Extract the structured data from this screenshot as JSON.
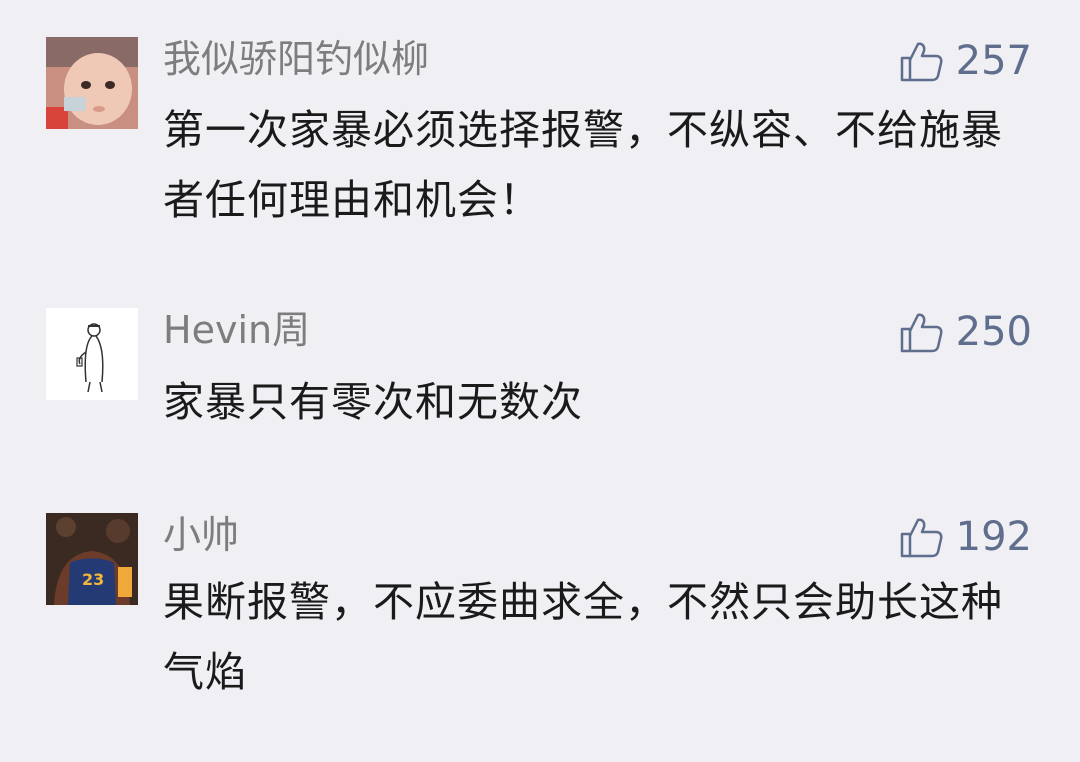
{
  "comments": [
    {
      "nickname": "我似骄阳钓似柳",
      "likes": "257",
      "content": "第一次家暴必须选择报警，不纵容、不给施暴者任何理由和机会！",
      "avatar_icon": "baby-photo-avatar"
    },
    {
      "nickname": "Hevin周",
      "likes": "250",
      "content": "家暴只有零次和无数次",
      "avatar_icon": "sketch-person-avatar"
    },
    {
      "nickname": "小帅",
      "likes": "192",
      "content": "果断报警，不应委曲求全，不然只会助长这种气焰",
      "avatar_icon": "basketball-player-avatar"
    }
  ],
  "like_icon": "thumbs-up-icon",
  "colors": {
    "background": "#efeff4",
    "nickname": "#7d7d7d",
    "like": "#5f6e8c",
    "content": "#1a1a1a"
  }
}
